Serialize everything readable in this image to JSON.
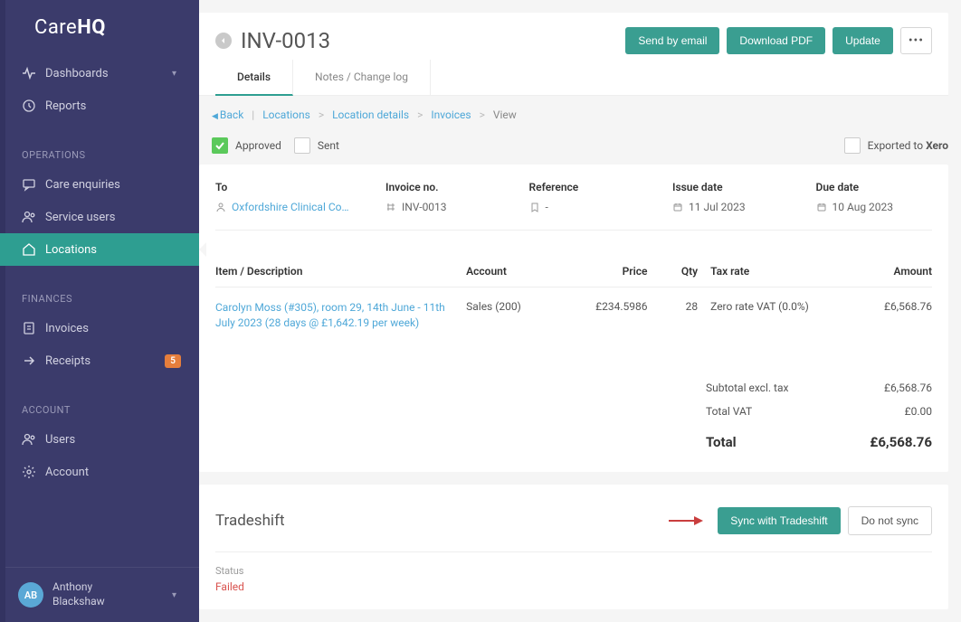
{
  "brand": {
    "part1": "Care",
    "part2": "HQ"
  },
  "sidebar": {
    "top": [
      {
        "label": "Dashboards",
        "icon": "pulse",
        "caret": true
      },
      {
        "label": "Reports",
        "icon": "clock"
      }
    ],
    "sections": [
      {
        "title": "OPERATIONS",
        "items": [
          {
            "label": "Care enquiries",
            "icon": "chat"
          },
          {
            "label": "Service users",
            "icon": "users"
          },
          {
            "label": "Locations",
            "icon": "home",
            "active": true
          }
        ]
      },
      {
        "title": "FINANCES",
        "items": [
          {
            "label": "Invoices",
            "icon": "invoice"
          },
          {
            "label": "Receipts",
            "icon": "arrow-right",
            "badge": "5"
          }
        ]
      },
      {
        "title": "ACCOUNT",
        "items": [
          {
            "label": "Users",
            "icon": "users"
          },
          {
            "label": "Account",
            "icon": "gear"
          }
        ]
      }
    ]
  },
  "user": {
    "initials": "AB",
    "line1": "Anthony",
    "line2": "Blackshaw"
  },
  "header": {
    "title": "INV-0013",
    "actions": {
      "send": "Send by email",
      "download": "Download PDF",
      "update": "Update"
    },
    "tabs": {
      "details": "Details",
      "notes": "Notes / Change log"
    }
  },
  "breadcrumb": {
    "back": "Back",
    "items": [
      "Locations",
      "Location details",
      "Invoices",
      "View"
    ]
  },
  "status": {
    "approved": "Approved",
    "sent": "Sent",
    "export_prefix": "Exported to ",
    "export_target": "Xero"
  },
  "meta": {
    "to_label": "To",
    "to_value": "Oxfordshire Clinical Com...",
    "invno_label": "Invoice no.",
    "invno_value": "INV-0013",
    "ref_label": "Reference",
    "ref_value": "-",
    "issue_label": "Issue date",
    "issue_value": "11 Jul 2023",
    "due_label": "Due date",
    "due_value": "10 Aug 2023"
  },
  "table": {
    "headers": {
      "desc": "Item / Description",
      "acct": "Account",
      "price": "Price",
      "qty": "Qty",
      "tax": "Tax rate",
      "amt": "Amount"
    },
    "rows": [
      {
        "desc": "Carolyn Moss (#305), room 29, 14th June - 11th July 2023 (28 days @ £1,642.19 per week)",
        "acct": "Sales (200)",
        "price": "£234.5986",
        "qty": "28",
        "tax": "Zero rate VAT (0.0%)",
        "amt": "£6,568.76"
      }
    ]
  },
  "totals": {
    "subtotal_label": "Subtotal excl. tax",
    "subtotal_value": "£6,568.76",
    "vat_label": "Total VAT",
    "vat_value": "£0.00",
    "total_label": "Total",
    "total_value": "£6,568.76"
  },
  "tradeshift": {
    "title": "Tradeshift",
    "sync_btn": "Sync with Tradeshift",
    "nosync_btn": "Do not sync",
    "status_label": "Status",
    "status_value": "Failed"
  }
}
